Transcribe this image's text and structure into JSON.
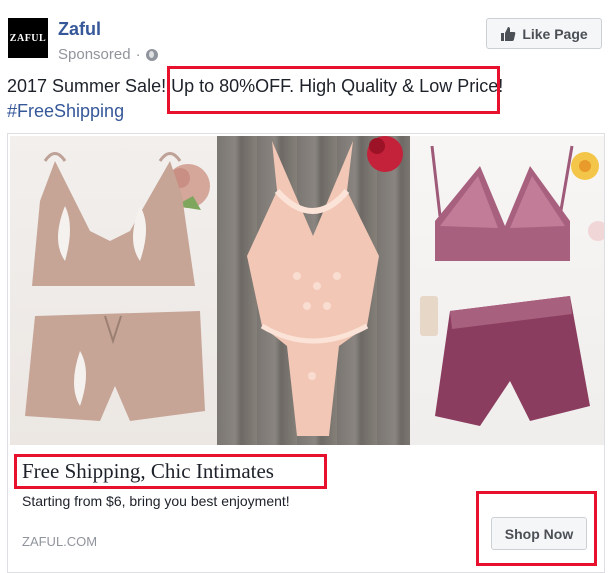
{
  "header": {
    "avatar_text": "ZAFUL",
    "page_name": "Zaful",
    "sponsored": "Sponsored",
    "separator": "·",
    "like_button": "Like Page"
  },
  "post": {
    "text": "2017 Summer Sale! Up to 80%OFF. High Quality & Low Price!",
    "hashtag": "#FreeShipping"
  },
  "link": {
    "headline": "Free Shipping, Chic Intimates",
    "description": "Starting from $6, bring you best enjoyment!",
    "domain": "ZAFUL.COM",
    "cta": "Shop Now"
  },
  "colors": {
    "link_blue": "#365899",
    "highlight_red": "#e8112d",
    "meta_gray": "#90949c"
  },
  "icons": {
    "like": "thumbs-up-icon",
    "audience": "globe-icon"
  }
}
